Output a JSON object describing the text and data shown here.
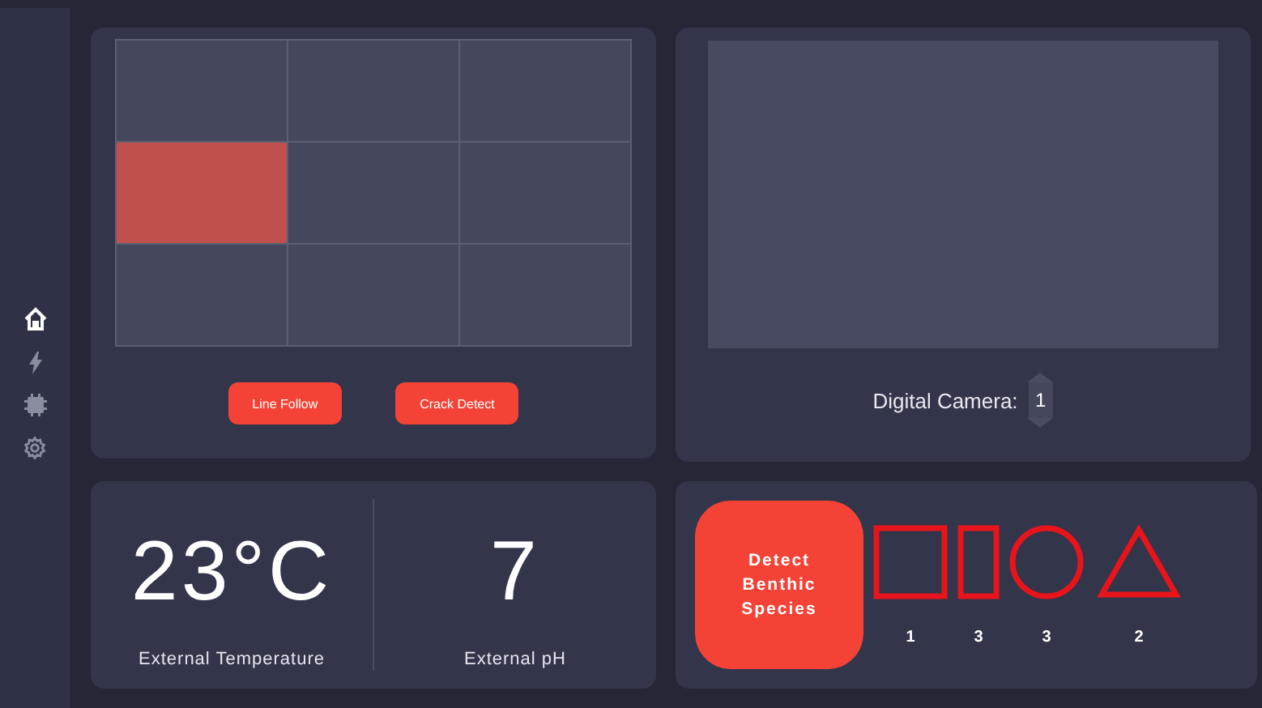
{
  "sidebar": {
    "items": [
      {
        "kind": "home",
        "selected": true
      },
      {
        "kind": "power",
        "selected": false
      },
      {
        "kind": "chip",
        "selected": false
      },
      {
        "kind": "settings",
        "selected": false
      }
    ]
  },
  "grid_panel": {
    "cells": [
      {
        "selected": false
      },
      {
        "selected": false
      },
      {
        "selected": false
      },
      {
        "selected": true
      },
      {
        "selected": false
      },
      {
        "selected": false
      },
      {
        "selected": false
      },
      {
        "selected": false
      },
      {
        "selected": false
      }
    ],
    "buttons": [
      "Line Follow",
      "Crack Detect"
    ]
  },
  "camera": {
    "label": "Digital Camera:",
    "value": "1"
  },
  "readings": [
    {
      "value": "23°C",
      "label": "External Temperature"
    },
    {
      "value": "7",
      "label": "External pH"
    }
  ],
  "species": {
    "button": "Detect Benthic Species",
    "shapes": [
      {
        "kind": "square",
        "count": "1"
      },
      {
        "kind": "rectangle",
        "count": "3"
      },
      {
        "kind": "circle",
        "count": "3"
      },
      {
        "kind": "triangle",
        "count": "2"
      }
    ]
  }
}
